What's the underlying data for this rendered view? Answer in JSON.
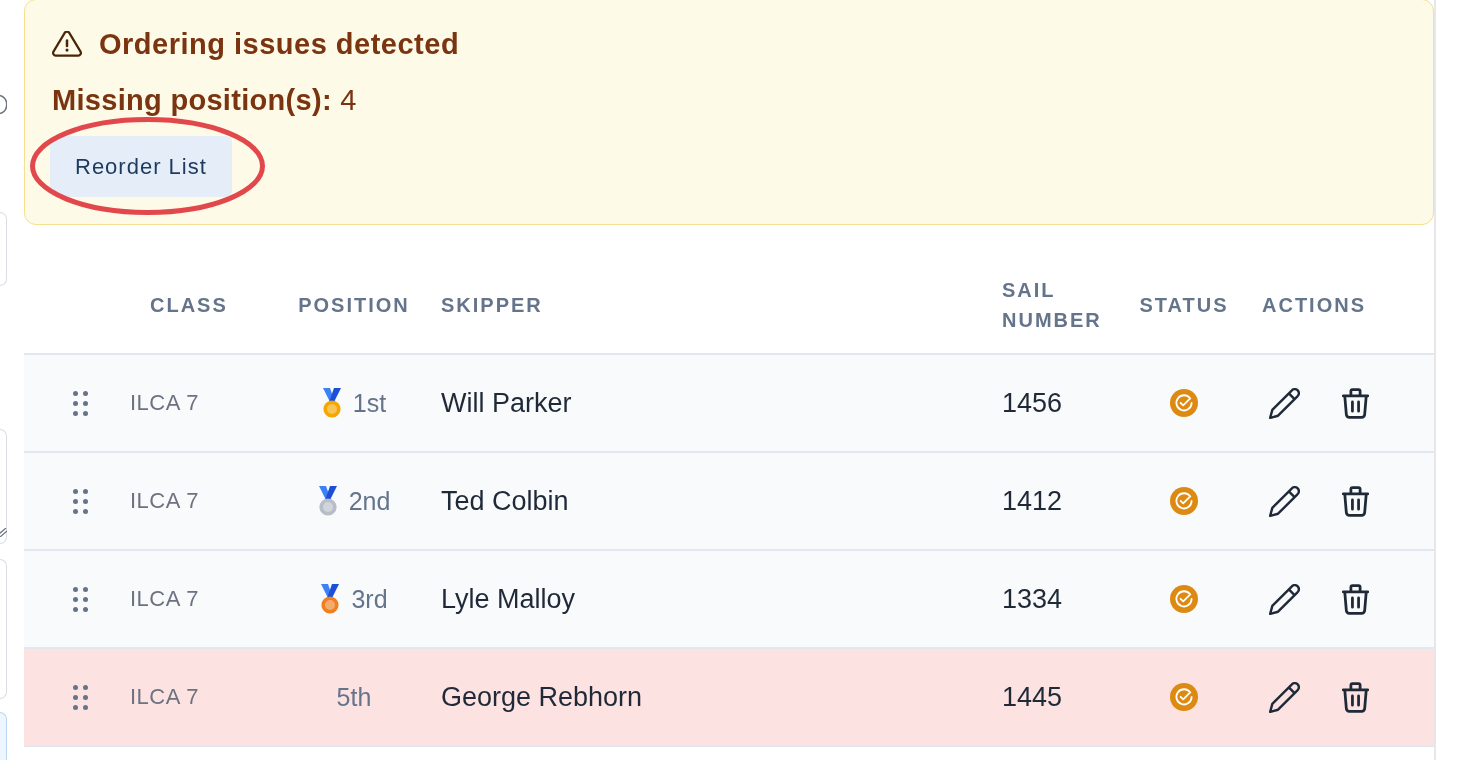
{
  "alert": {
    "title": "Ordering issues detected",
    "message": "**Missing position(s):** 4",
    "button": {
      "label": "Reorder List",
      "circled": true
    }
  },
  "table": {
    "columns": [
      "CLASS",
      "POSITION",
      "SKIPPER",
      "SAIL NUMBER",
      "STATUS",
      "ACTIONS"
    ],
    "rows": [
      {
        "class": "ILCA 7",
        "medal": {
          "color": "#f5a700"
        },
        "position": "1st",
        "skipper": "Will Parker",
        "sail_number": "1456",
        "confirmed": true,
        "flagged": false
      },
      {
        "class": "ILCA 7",
        "medal": {
          "color": "#b8bec8"
        },
        "position": "2nd",
        "skipper": "Ted Colbin",
        "sail_number": "1412",
        "confirmed": true,
        "flagged": false
      },
      {
        "class": "ILCA 7",
        "medal": {
          "color": "#f07f1f"
        },
        "position": "3rd",
        "skipper": "Lyle Malloy",
        "sail_number": "1334",
        "confirmed": true,
        "flagged": false
      },
      {
        "class": "ILCA 7",
        "position": "5th",
        "skipper": "George Rebhorn",
        "sail_number": "1445",
        "confirmed": true,
        "flagged": true
      }
    ]
  }
}
